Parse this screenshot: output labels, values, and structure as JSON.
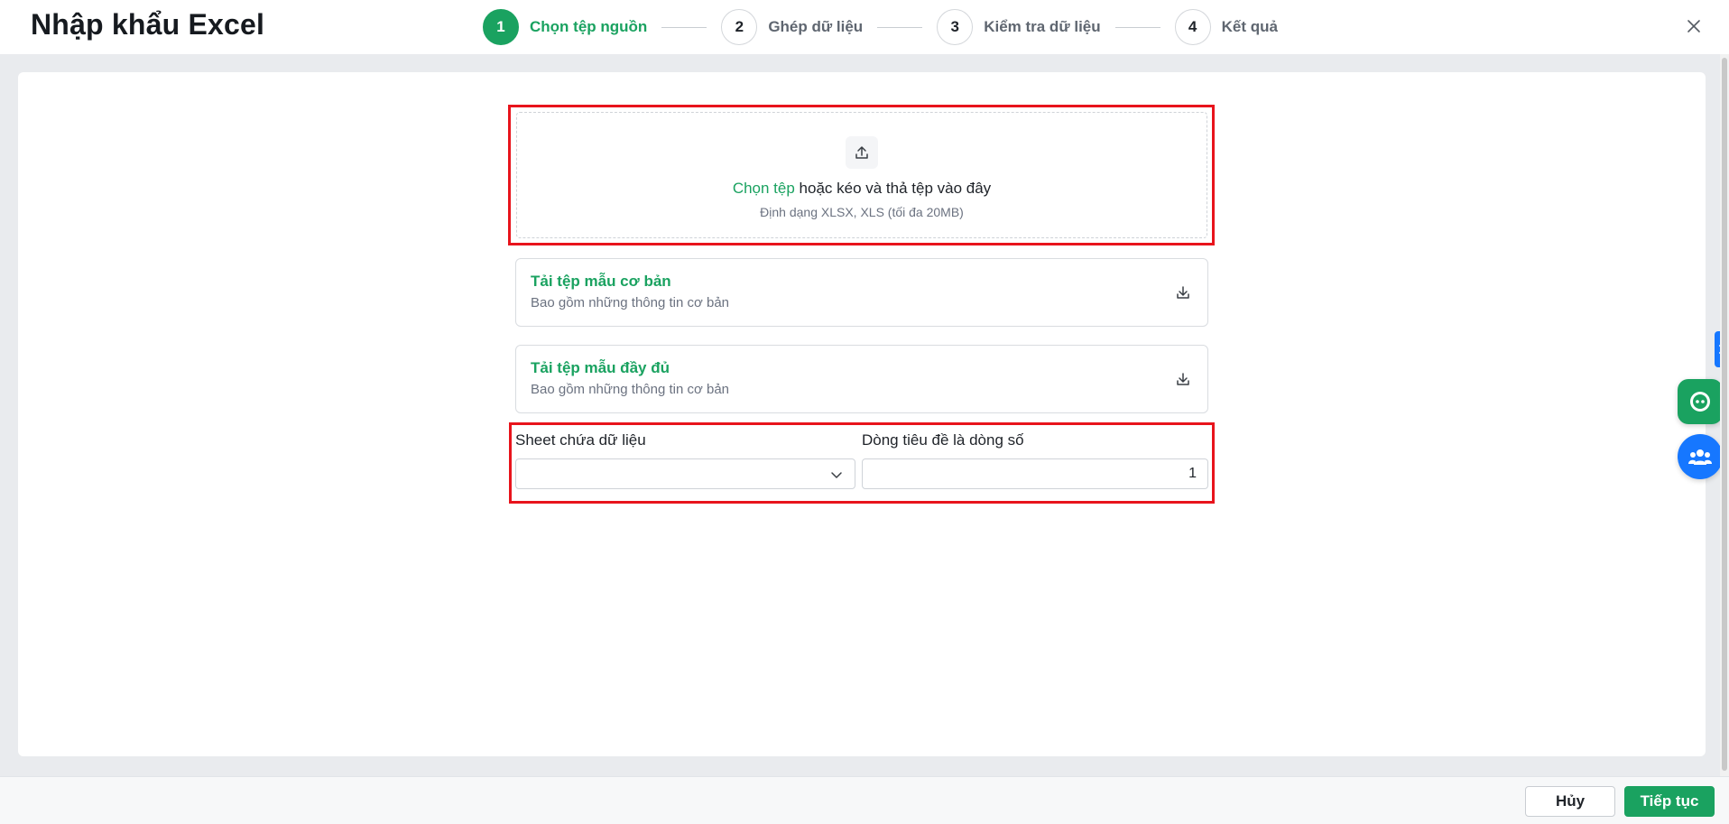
{
  "dialog": {
    "title": "Nhập khẩu Excel",
    "close_icon": "close-icon"
  },
  "stepper": {
    "active_step": 1,
    "steps": [
      {
        "number": "1",
        "label": "Chọn tệp nguồn"
      },
      {
        "number": "2",
        "label": "Ghép dữ liệu"
      },
      {
        "number": "3",
        "label": "Kiểm tra dữ liệu"
      },
      {
        "number": "4",
        "label": "Kết quả"
      }
    ]
  },
  "upload": {
    "icon": "upload-icon",
    "link_text": "Chọn tệp",
    "text": " hoặc kéo và thả tệp vào đây",
    "hint": "Định dạng XLSX, XLS (tối đa 20MB)"
  },
  "templates": [
    {
      "title": "Tải tệp mẫu cơ bản",
      "description": "Bao gồm những thông tin cơ bản",
      "icon": "download-icon"
    },
    {
      "title": "Tải tệp mẫu đầy đủ",
      "description": "Bao gồm những thông tin cơ bản",
      "icon": "download-icon"
    }
  ],
  "settings": {
    "sheet_label": "Sheet chứa dữ liệu",
    "sheet_value": "",
    "header_row_label": "Dòng tiêu đề là dòng số",
    "header_row_value": "1"
  },
  "footer": {
    "cancel_label": "Hủy",
    "next_label": "Tiếp tục"
  },
  "colors": {
    "accent": "#1aa260",
    "highlight": "#e8141c",
    "blue": "#1677ff"
  }
}
